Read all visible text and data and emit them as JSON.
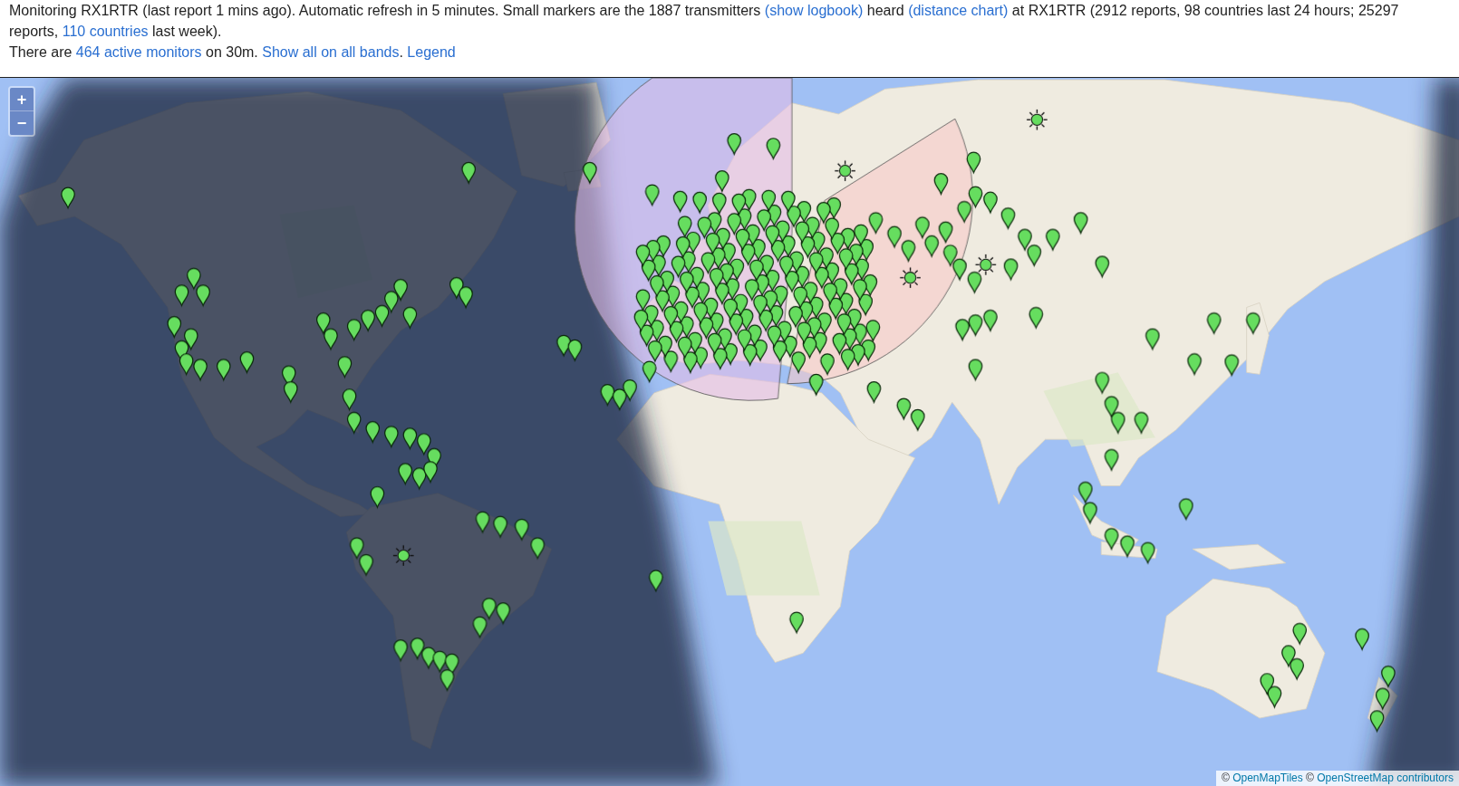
{
  "header": {
    "paragraphs": [
      [
        {
          "kind": "text",
          "text": "Monitoring RX1RTR (last report 1 mins ago). Automatic refresh in 5 minutes. Small markers are the 1887 transmitters "
        },
        {
          "kind": "link",
          "text": "(show logbook)"
        },
        {
          "kind": "text",
          "text": " heard "
        },
        {
          "kind": "link",
          "text": "(distance chart)"
        },
        {
          "kind": "text",
          "text": " at RX1RTR (2912 reports, 98 countries last 24 hours; 25297 reports, "
        },
        {
          "kind": "link",
          "text": "110 countries"
        },
        {
          "kind": "text",
          "text": " last week)."
        }
      ],
      [
        {
          "kind": "text",
          "text": "There are "
        },
        {
          "kind": "link",
          "text": "464 active monitors"
        },
        {
          "kind": "text",
          "text": " on 30m. "
        },
        {
          "kind": "link",
          "text": "Show all on all bands"
        },
        {
          "kind": "text",
          "text": ". "
        },
        {
          "kind": "link",
          "text": "Legend"
        }
      ]
    ]
  },
  "map": {
    "zoom_controls": [
      {
        "kind": "zoom_in",
        "label": "+"
      },
      {
        "kind": "zoom_out",
        "label": "−"
      }
    ],
    "attribution": [
      {
        "kind": "text",
        "text": "© "
      },
      {
        "kind": "link",
        "text": "OpenMapTiles"
      },
      {
        "kind": "text",
        "text": " © "
      },
      {
        "kind": "link",
        "text": "OpenStreetMap contributors"
      }
    ]
  }
}
